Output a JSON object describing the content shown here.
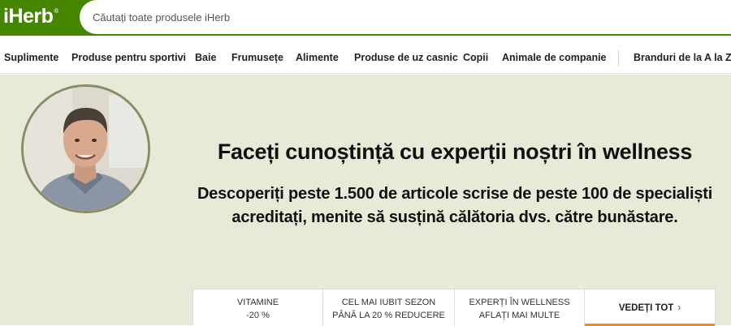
{
  "brand": {
    "logo_text": "iHerb",
    "logo_mark": "®",
    "color": "#458500"
  },
  "search": {
    "placeholder": "Căutați toate produsele iHerb"
  },
  "nav": {
    "items": [
      {
        "label": "Suplimente"
      },
      {
        "label": "Produse pentru sportivi"
      },
      {
        "label": "Baie"
      },
      {
        "label": "Frumusețe"
      },
      {
        "label": "Alimente"
      },
      {
        "label": "Produse de uz casnic"
      },
      {
        "label": "Copii"
      },
      {
        "label": "Animale de companie"
      },
      {
        "label": "Branduri de la A la Z"
      }
    ]
  },
  "hero": {
    "title": "Faceți cunoștință cu experții noștri în wellness",
    "subtitle_line1": "Descoperiți peste 1.500 de articole scrise de peste 100 de specialiști",
    "subtitle_line2": "acreditați, menite să susțină călătoria dvs. către bunăstare.",
    "background": "#e7ead7",
    "avatar_ring_color": "#8a8c64"
  },
  "promo": {
    "tabs": [
      {
        "line1": "VITAMINE",
        "line2": "-20 %"
      },
      {
        "line1": "CEL MAI IUBIT SEZON",
        "line2": "PÂNĂ LA 20 % REDUCERE"
      },
      {
        "line1": "EXPERȚI ÎN WELLNESS",
        "line2": "AFLAȚI MAI MULTE"
      }
    ],
    "cta_label": "VEDEȚI TOT",
    "cta_icon": "chevron-right-icon",
    "cta_accent": "#f08a24"
  }
}
